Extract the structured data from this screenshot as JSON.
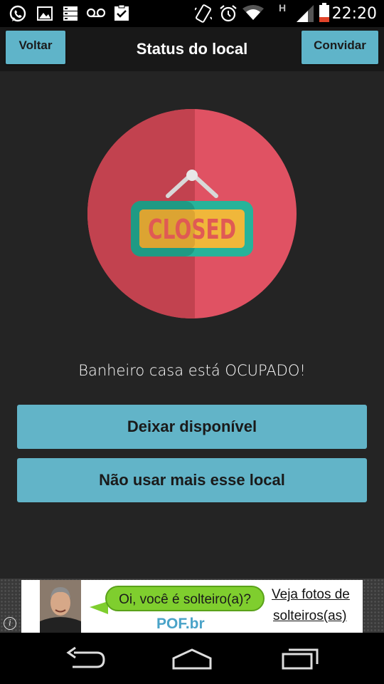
{
  "status_bar": {
    "time": "22:20",
    "network_label": "H",
    "icons": [
      "whatsapp-icon",
      "gallery-icon",
      "storage-icon",
      "voicemail-icon",
      "clipboard-check-icon",
      "vibrate-icon",
      "alarm-icon",
      "wifi-icon",
      "signal-icon",
      "battery-icon"
    ]
  },
  "action_bar": {
    "back_label": "Voltar",
    "title": "Status do local",
    "invite_label": "Convidar"
  },
  "main": {
    "sign_text": "CLOSED",
    "status_message": "Banheiro casa está OCUPADO!",
    "make_available_label": "Deixar disponível",
    "stop_using_label": "Não usar mais esse local"
  },
  "ad": {
    "bubble_text": "Oi, você é solteiro(a)?",
    "brand": "POF.br",
    "cta_line1": "Veja fotos de",
    "cta_line2": "solteiros(as)",
    "info_glyph": "i"
  },
  "nav_bar": {
    "icons": [
      "back-icon",
      "home-icon",
      "recent-apps-icon"
    ]
  },
  "colors": {
    "accent": "#62b4c8",
    "background": "#242424",
    "circle_light": "#e05263",
    "circle_dark": "#c2424f",
    "sign_frame": "#26b39a",
    "sign_fill": "#f0b73a",
    "sign_text": "#e05a54"
  }
}
